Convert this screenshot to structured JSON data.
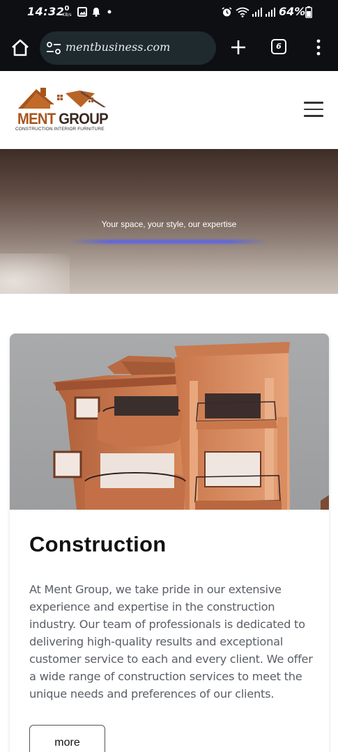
{
  "status_bar": {
    "time": "14:32",
    "net_speed_value": "0",
    "net_speed_unit": "KB/s",
    "battery_text": "64%",
    "icons": [
      "gallery-icon",
      "notification-icon",
      "dot-icon",
      "alarm-icon",
      "wifi-icon",
      "signal-icon",
      "signal-icon",
      "battery-icon"
    ]
  },
  "browser": {
    "url": "mentbusiness.com",
    "tab_count": "6",
    "icons": [
      "home-icon",
      "site-settings-icon",
      "new-tab-icon",
      "tabs-icon",
      "more-menu-icon"
    ]
  },
  "header": {
    "logo_name_part1": "MENT ",
    "logo_name_part2": "GROUP",
    "logo_tagline": "CONSTRUCTION  INTERIOR  FURNITURE",
    "menu_icon": "hamburger-icon"
  },
  "hero": {
    "tagline": "Your space, your style, our expertise"
  },
  "card": {
    "title": "Construction",
    "body": "At Ment Group, we take pride in our extensive experience and expertise in the construction industry. Our team of professionals is dedicated to delivering high-quality results and exceptional customer service to each and every client. We offer a wide range of construction services to meet the unique needs and preferences of our clients.",
    "button_label": "more"
  },
  "colors": {
    "brand_orange": "#a8551b",
    "brand_dark": "#3b2a22",
    "browser_bg": "#0d0f13",
    "urlbar_bg": "#1f2a2e"
  }
}
